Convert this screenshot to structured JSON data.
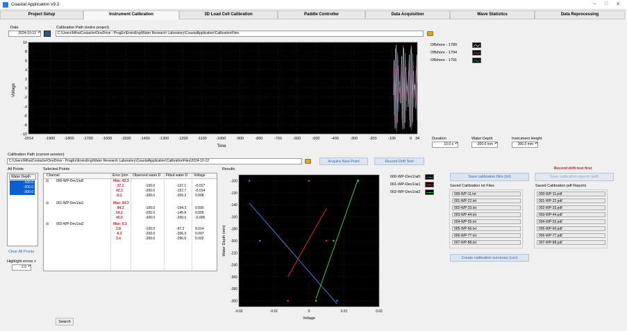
{
  "window": {
    "title": "Coastal Application v9.2"
  },
  "tabs": [
    "Project Setup",
    "Instrument Calibration",
    "3D Load Cell Calibration",
    "Paddle Controller",
    "Data Acquisition",
    "Wave Statistics",
    "Data Reprocessing"
  ],
  "header": {
    "date_label": "Date",
    "date_value": "2024-10-12",
    "cal_path_label": "Calibration Path (entire project)",
    "cal_path_value": "C:\\Users\\MihaiCostache\\OneDrive - ProgEv\\EnvisEng\\Water Research Laboratory\\CoastalApplication\\CalibrationFiles"
  },
  "time_plot": {
    "x_label": "Time",
    "y_label": "Voltage",
    "x_ticks": [
      "-2014",
      "-1900",
      "-1800",
      "-1700",
      "-1600",
      "-1500",
      "-1400",
      "-1300",
      "-1200",
      "-1100",
      "-1000",
      "-900",
      "-800",
      "-700",
      "-600",
      "-500",
      "-400",
      "-300",
      "-200",
      "-100",
      "0",
      "34"
    ],
    "y_ticks": [
      "10",
      "8",
      "6",
      "4",
      "2",
      "0",
      "-2",
      "-4",
      "-6",
      "-8",
      "-10"
    ],
    "legend": [
      "Offshore - 1789",
      "Offshore - 1794",
      "Offshore - 1791"
    ],
    "colors": {
      "s1": "#ffffff",
      "s2": "#e83a8c",
      "s3": "#3fae9f"
    }
  },
  "params": {
    "duration_label": "Duration",
    "duration_value": "10.0 s",
    "water_depth_label": "Water Depth",
    "water_depth_value": "-300.0 mm",
    "inst_height_label": "Instrument Height",
    "inst_height_value": "300.0 mm"
  },
  "session": {
    "label": "Calibration Path (current session)",
    "value": "C:\\Users\\MihaiCostache\\OneDrive - ProgEv\\EnvisEng\\Water Research Laboratory\\CoastalApplication\\CalibrationFiles\\2024-10-12",
    "acquire_btn": "Acquire New Point",
    "drift_btn": "Record Drift Test"
  },
  "all_points": {
    "label": "All Points",
    "header": "Water Depth",
    "items": [
      "-100.0",
      "-200.0",
      "-300.0"
    ],
    "clear_btn": "Clear All Points",
    "highlight_label": "Highlight errors >",
    "highlight_value": "2.0"
  },
  "selected_points": {
    "label": "Selected Points",
    "columns": [
      "Channel",
      "Error (mm",
      "Observed water D",
      "Fitted water D",
      "Voltage"
    ],
    "groups": [
      {
        "channel": "000-WP-Dev1/ai0",
        "max": "Max: 42.3",
        "errors": [
          "-37.1",
          "42.3",
          "-5.2"
        ],
        "observed": [
          "-100.0",
          "-200.0",
          "-300.0"
        ],
        "fitted": [
          "-137.1",
          "-157.7",
          "-305.2"
        ],
        "voltage": [
          "-0.017",
          "-0.014",
          "0.008"
        ]
      },
      {
        "channel": "001-WP-Dev1/ai1",
        "max": "Max: 94.3",
        "errors": [
          "-94.3",
          "54.2",
          "40.0"
        ],
        "observed": [
          "-100.0",
          "-200.0",
          "-300.0"
        ],
        "fitted": [
          "-194.3",
          "-145.8",
          "-260.0"
        ],
        "voltage": [
          "0.000",
          "0.005",
          "-0.006"
        ]
      },
      {
        "channel": "002-WP-Dev1/ai2",
        "max": "Max: 6.3",
        "errors": [
          "2.8",
          "-6.3",
          "3.4"
        ],
        "observed": [
          "-100.0",
          "-200.0",
          "-300.0"
        ],
        "fitted": [
          "-97.2",
          "-206.3",
          "-296.6"
        ],
        "voltage": [
          "0.014",
          "0.007",
          "0.002"
        ]
      }
    ],
    "search_btn": "Search"
  },
  "results": {
    "label": "Results",
    "x_label": "Voltage",
    "y_label": "Water Depth (mm)",
    "x_ticks": [
      "-0.02",
      "-0.01",
      "0",
      "0.01",
      "0.02"
    ],
    "y_ticks": [
      "-100",
      "-120",
      "-140",
      "-160",
      "-180",
      "-200",
      "-220",
      "-240",
      "-260",
      "-280",
      "-300"
    ],
    "legend": [
      "000-WP-Dev1/ai0",
      "001-WP-Dev1/ai1",
      "002-WP-Dev1/ai2"
    ],
    "colors": {
      "ai0": "#3a7fd5",
      "ai1": "#e42a2a",
      "ai2": "#3fc83f"
    }
  },
  "chart_data": {
    "type": "scatter",
    "title": "",
    "xlabel": "Voltage",
    "ylabel": "Water Depth (mm)",
    "xlim": [
      -0.02,
      0.02
    ],
    "ylim": [
      -310,
      -90
    ],
    "series": [
      {
        "name": "000-WP-Dev1/ai0",
        "points": [
          [
            -0.017,
            -100.0
          ],
          [
            -0.014,
            -200.0
          ],
          [
            0.008,
            -300.0
          ]
        ],
        "fit": [
          [
            -0.017,
            -137.1
          ],
          [
            0.008,
            -305.2
          ]
        ]
      },
      {
        "name": "001-WP-Dev1/ai1",
        "points": [
          [
            0.0,
            -100.0
          ],
          [
            0.005,
            -200.0
          ],
          [
            -0.006,
            -300.0
          ]
        ],
        "fit": [
          [
            -0.006,
            -260.0
          ],
          [
            0.005,
            -145.8
          ]
        ]
      },
      {
        "name": "002-WP-Dev1/ai2",
        "points": [
          [
            0.014,
            -100.0
          ],
          [
            0.007,
            -200.0
          ],
          [
            0.002,
            -300.0
          ]
        ],
        "fit": [
          [
            0.002,
            -296.6
          ],
          [
            0.014,
            -97.2
          ]
        ]
      }
    ]
  },
  "files": {
    "save_txt_btn": "Save calibration files (txt)",
    "save_pdf_btn": "Save calibration reports (pdf)",
    "drift_warning": "Record drift test first",
    "txt_label": "Saved Calibration txt Files",
    "pdf_label": "Saved Calibration pdf Reports",
    "txt_files": [
      "000-WP-11.txt",
      "001-WP-22.txt",
      "002-WP-33.txt",
      "003-WP-44.txt",
      "004-WP-55.txt",
      "005-WP-66.txt",
      "006-WP-77.txt",
      "007-WP-88.txt"
    ],
    "pdf_files": [
      "000-WP-11.pdf",
      "001-WP-22.pdf",
      "002-WP-33.pdf",
      "003-WP-44.pdf",
      "004-WP-55.pdf",
      "005-WP-66.pdf",
      "006-WP-77.pdf",
      "007-WP-88.pdf"
    ],
    "summary_btn": "Create calibration summary (csv)"
  }
}
